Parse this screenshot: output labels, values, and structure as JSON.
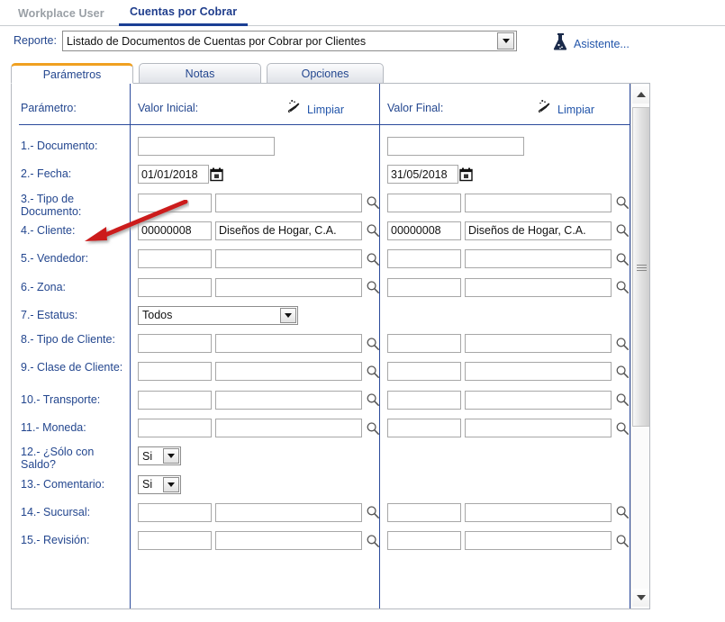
{
  "module_tabs": [
    {
      "label": "Workplace User",
      "active": false
    },
    {
      "label": "Cuentas por Cobrar",
      "active": true
    }
  ],
  "report": {
    "label": "Reporte:",
    "value": "Listado de Documentos de Cuentas por Cobrar por Clientes",
    "assistant_label": "Asistente...",
    "assistant_icon": "wizard-flask-icon",
    "dropdown_icon": "chevron-down-icon"
  },
  "tabs": [
    {
      "label": "Parámetros",
      "active": true
    },
    {
      "label": "Notas",
      "active": false
    },
    {
      "label": "Opciones",
      "active": false
    }
  ],
  "columns": {
    "parameter": "Parámetro:",
    "initial": "Valor Inicial:",
    "final": "Valor Final:",
    "clear_label": "Limpiar",
    "clear_icon": "broom-icon"
  },
  "rows": [
    {
      "label": "1.- Documento:",
      "type": "single",
      "initial": "",
      "final": ""
    },
    {
      "label": "2.- Fecha:",
      "type": "date",
      "initial": "01/01/2018",
      "final": "31/05/2018"
    },
    {
      "label": "3.- Tipo de Documento:",
      "type": "lookup",
      "initial_code": "",
      "initial_desc": "",
      "final_code": "",
      "final_desc": ""
    },
    {
      "label": "4.- Cliente:",
      "type": "lookup",
      "initial_code": "00000008",
      "initial_desc": "Diseños de Hogar, C.A.",
      "final_code": "00000008",
      "final_desc": "Diseños de Hogar, C.A."
    },
    {
      "label": "5.- Vendedor:",
      "type": "lookup",
      "initial_code": "",
      "initial_desc": "",
      "final_code": "",
      "final_desc": ""
    },
    {
      "label": "6.- Zona:",
      "type": "lookup",
      "initial_code": "",
      "initial_desc": "",
      "final_code": "",
      "final_desc": ""
    },
    {
      "label": "7.- Estatus:",
      "type": "select-wide",
      "initial": "Todos"
    },
    {
      "label": "8.- Tipo de Cliente:",
      "type": "lookup",
      "initial_code": "",
      "initial_desc": "",
      "final_code": "",
      "final_desc": ""
    },
    {
      "label": "9.- Clase de Cliente:",
      "type": "lookup",
      "initial_code": "",
      "initial_desc": "",
      "final_code": "",
      "final_desc": ""
    },
    {
      "label": "10.- Transporte:",
      "type": "lookup",
      "initial_code": "",
      "initial_desc": "",
      "final_code": "",
      "final_desc": ""
    },
    {
      "label": "11.- Moneda:",
      "type": "lookup",
      "initial_code": "",
      "initial_desc": "",
      "final_code": "",
      "final_desc": ""
    },
    {
      "label": "12.- ¿Sólo con Saldo?",
      "type": "select-narrow",
      "initial": "Si"
    },
    {
      "label": "13.- Comentario:",
      "type": "select-narrow",
      "initial": "Si"
    },
    {
      "label": "14.- Sucursal:",
      "type": "lookup",
      "initial_code": "",
      "initial_desc": "",
      "final_code": "",
      "final_desc": ""
    },
    {
      "label": "15.- Revisión:",
      "type": "lookup",
      "initial_code": "",
      "initial_desc": "",
      "final_code": "",
      "final_desc": ""
    }
  ],
  "annotation": {
    "shape": "red-arrow",
    "points_at": "4.- Cliente:",
    "color": "#cc1f1f"
  },
  "scrollbar": {
    "up_icon": "triangle-up-icon",
    "down_icon": "triangle-down-icon",
    "thumb": "scroll-thumb"
  },
  "colors": {
    "accent_orange": "#f0a020",
    "link_blue": "#2255aa",
    "label_blue": "#24478f",
    "separator_blue": "#2b4a9b"
  }
}
